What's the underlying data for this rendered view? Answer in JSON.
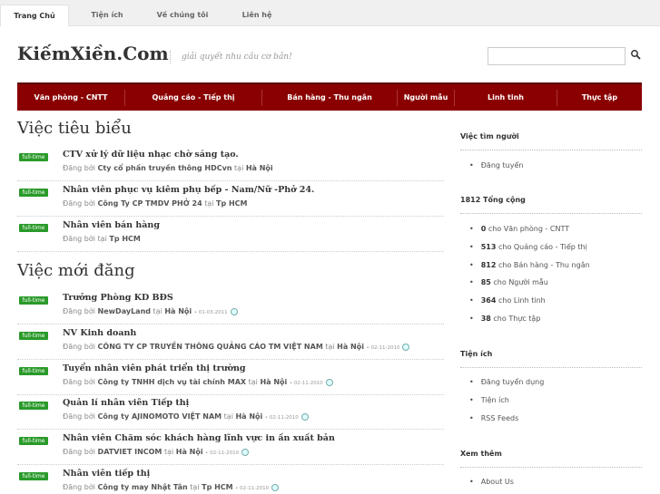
{
  "topnav": [
    {
      "label": "Trang Chủ",
      "active": true
    },
    {
      "label": "Tiện ích",
      "active": false
    },
    {
      "label": "Về chúng tôi",
      "active": false
    },
    {
      "label": "Liên hệ",
      "active": false
    }
  ],
  "brand": {
    "name": "KiếmXiền.Com",
    "tagline": "giải quyết nhu cầu cơ bản!"
  },
  "search": {
    "placeholder": ""
  },
  "mainnav": [
    "Văn phòng - CNTT",
    "Quảng cáo - Tiếp thị",
    "Bán hàng - Thu ngân",
    "Người mẫu",
    "Linh tinh",
    "Thực tập"
  ],
  "featured": {
    "title": "Việc tiêu biểu",
    "jobs": [
      {
        "badge": "full-time",
        "title": "CTV xử lý dữ liệu nhạc chờ sáng tạo.",
        "by": "Đăng bởi",
        "company": "Cty cổ phần truyền thông HDCvn",
        "at": "tại",
        "location": "Hà Nội"
      },
      {
        "badge": "full-time",
        "title": "Nhân viên phục vụ kiêm phụ bếp - Nam/Nữ -Phở 24.",
        "by": "Đăng bởi",
        "company": "Công Ty CP TMDV PHỞ 24",
        "at": "tại",
        "location": "Tp HCM"
      },
      {
        "badge": "full-time",
        "title": "Nhân viên bán hàng",
        "by": "Đăng bởi",
        "company": "",
        "at": "tại",
        "location": "Tp HCM"
      }
    ]
  },
  "recent": {
    "title": "Việc mới đăng",
    "jobs": [
      {
        "badge": "full-time",
        "title": "Trưởng Phòng KD BĐS",
        "by": "Đăng bởi",
        "company": "NewDayLand",
        "at": "tại",
        "location": "Hà Nội",
        "date": "01-03-2011"
      },
      {
        "badge": "full-time",
        "title": "NV Kinh doanh",
        "by": "Đăng bởi",
        "company": "CÔNG TY CP TRUYỀN THÔNG QUẢNG CÁO TM VIỆT NAM",
        "at": "tại",
        "location": "Hà Nội",
        "date": "02-11-2010"
      },
      {
        "badge": "full-time",
        "title": "Tuyển nhân viên phát triển thị trường",
        "by": "Đăng bởi",
        "company": "Công ty TNHH dịch vụ tài chính MAX",
        "at": "tại",
        "location": "Hà Nội",
        "date": "02-11-2010"
      },
      {
        "badge": "full-time",
        "title": "Quản lí nhân viên Tiếp thị",
        "by": "Đăng bởi",
        "company": "Công ty AJINOMOTO VIỆT NAM",
        "at": "tại",
        "location": "Hà Nội",
        "date": "02-11-2010"
      },
      {
        "badge": "full-time",
        "title": "Nhân viên Chăm sóc khách hàng lĩnh vực in ấn xuất bản",
        "by": "Đăng bởi",
        "company": "DATVIET INCOM",
        "at": "tại",
        "location": "Hà Nội",
        "date": "02-11-2010"
      },
      {
        "badge": "full-time",
        "title": "Nhân viên tiếp thị",
        "by": "Đăng bởi",
        "company": "Công ty may Nhật Tân",
        "at": "tại",
        "location": "Tp HCM",
        "date": "02-11-2010"
      }
    ]
  },
  "sidebar": {
    "find": {
      "title": "Việc tìm người",
      "items": [
        "Đăng tuyển"
      ]
    },
    "total": {
      "title": "1812 Tổng cộng",
      "items": [
        {
          "count": "0",
          "label": "cho Văn phòng - CNTT"
        },
        {
          "count": "513",
          "label": "cho Quảng cáo - Tiếp thị"
        },
        {
          "count": "812",
          "label": "cho Bán hàng - Thu ngân"
        },
        {
          "count": "85",
          "label": "cho Người mẫu"
        },
        {
          "count": "364",
          "label": "cho Linh tinh"
        },
        {
          "count": "38",
          "label": "cho Thực tập"
        }
      ]
    },
    "utils": {
      "title": "Tiện ích",
      "items": [
        "Đăng tuyển dụng",
        "Tiện ích",
        "RSS Feeds"
      ]
    },
    "more": {
      "title": "Xem thêm",
      "items": [
        "About Us"
      ]
    }
  }
}
